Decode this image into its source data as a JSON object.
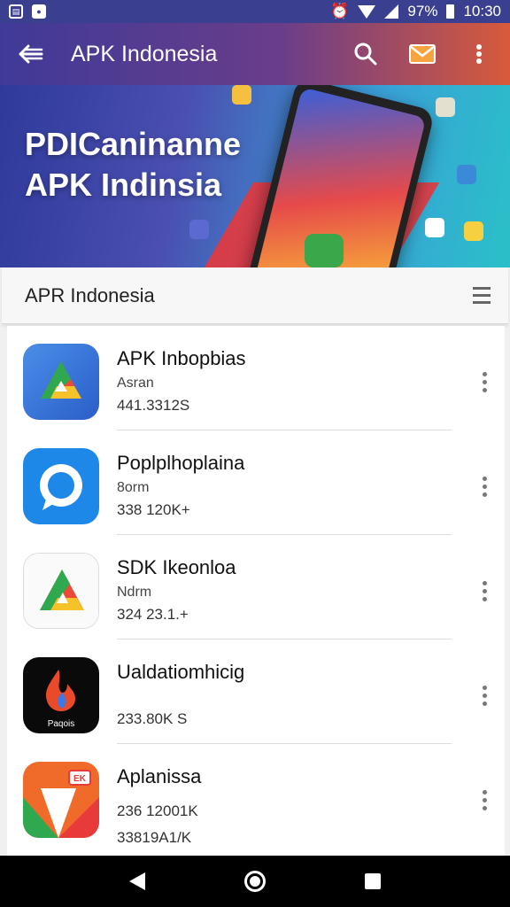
{
  "status_bar": {
    "battery": "97%",
    "time": "10:30"
  },
  "app_bar": {
    "title": "APK Indonesia",
    "icons": [
      "back-arrow-icon",
      "search-icon",
      "mail-icon",
      "more-vert-icon"
    ]
  },
  "banner": {
    "line1": "PDICaninanne",
    "line2": "APK Indinsia"
  },
  "section": {
    "title": "APR Indonesia",
    "icon": "menu-icon"
  },
  "apps": [
    {
      "name": "APK Inbopbias",
      "developer": "Asran",
      "size": "441.3312S",
      "icon": "drive-triangle-icon"
    },
    {
      "name": "Poplplhoplaina",
      "developer": "8orm",
      "size": "338 120K+",
      "icon": "chat-bubble-icon"
    },
    {
      "name": "SDK Ikeonloa",
      "developer": "Ndrm",
      "size": "324 23.1.+",
      "icon": "drive-triangle-icon"
    },
    {
      "name": "Ualdatiomhicig",
      "developer": "",
      "size": "233.80K S",
      "icon": "flame-logo-icon",
      "icon_caption": "Paqois"
    },
    {
      "name": "Aplanissa",
      "developer": "",
      "size": "236 12001K",
      "size2": "33819A1/K",
      "icon": "folded-arrow-icon",
      "icon_badge": "EK"
    }
  ],
  "nav_bar": {
    "icons": [
      "back-icon",
      "home-icon",
      "recents-icon"
    ]
  }
}
